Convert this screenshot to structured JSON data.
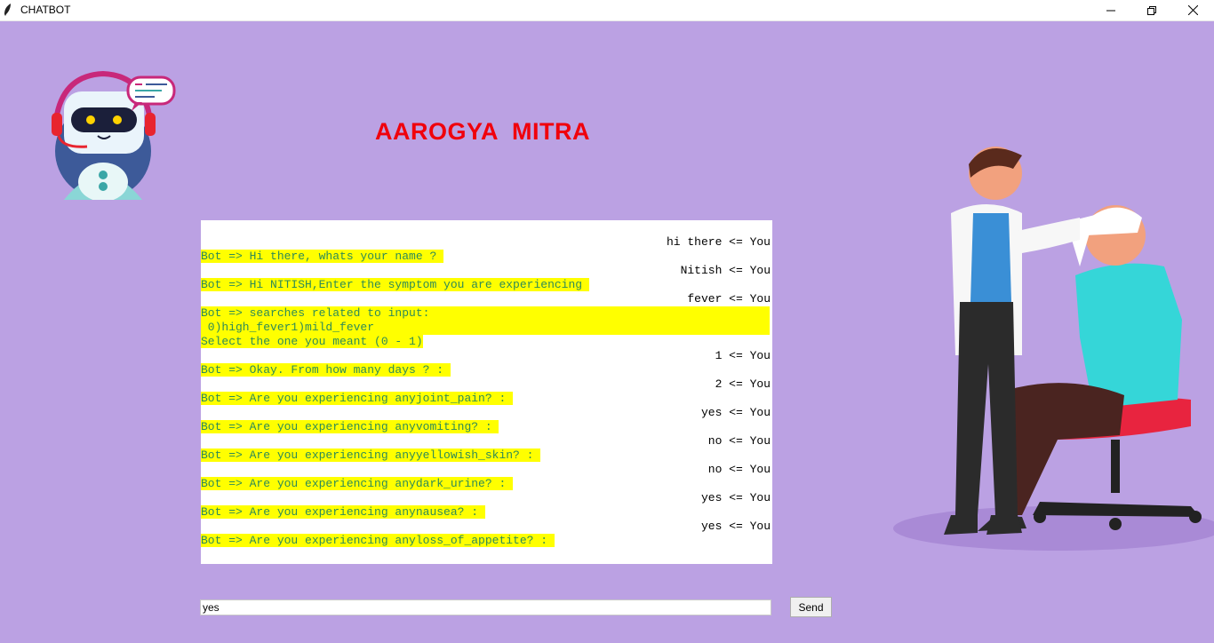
{
  "window": {
    "title": "CHATBOT"
  },
  "heading": "AAROGYA  MITRA",
  "chat": [
    {
      "role": "user",
      "text": "hi there <= You"
    },
    {
      "role": "bot",
      "text": "Bot => Hi there, whats your name ? "
    },
    {
      "role": "user",
      "text": "Nitish <= You"
    },
    {
      "role": "bot",
      "text": "Bot => Hi NITISH,Enter the symptom you are experiencing "
    },
    {
      "role": "user",
      "text": "fever <= You"
    },
    {
      "role": "bot-full",
      "text": "Bot => searches related to input: "
    },
    {
      "role": "bot-full",
      "text": " 0)high_fever1)mild_fever"
    },
    {
      "role": "bot",
      "text": "Select the one you meant (0 - 1)"
    },
    {
      "role": "user",
      "text": "1 <= You"
    },
    {
      "role": "bot",
      "text": "Bot => Okay. From how many days ? : "
    },
    {
      "role": "user",
      "text": "2 <= You"
    },
    {
      "role": "bot",
      "text": "Bot => Are you experiencing anyjoint_pain? : "
    },
    {
      "role": "user",
      "text": "yes <= You"
    },
    {
      "role": "bot",
      "text": "Bot => Are you experiencing anyvomiting? : "
    },
    {
      "role": "user",
      "text": "no <= You"
    },
    {
      "role": "bot",
      "text": "Bot => Are you experiencing anyyellowish_skin? : "
    },
    {
      "role": "user",
      "text": "no <= You"
    },
    {
      "role": "bot",
      "text": "Bot => Are you experiencing anydark_urine? : "
    },
    {
      "role": "user",
      "text": "yes <= You"
    },
    {
      "role": "bot",
      "text": "Bot => Are you experiencing anynausea? : "
    },
    {
      "role": "user",
      "text": "yes <= You"
    },
    {
      "role": "bot",
      "text": "Bot => Are you experiencing anyloss_of_appetite? : "
    }
  ],
  "input": {
    "value": "yes"
  },
  "send_label": "Send",
  "icons": {
    "app": "feather-icon",
    "minimize": "minimize-icon",
    "maximize": "restore-icon",
    "close": "close-icon",
    "logo": "robot-headset-icon",
    "illustration": "doctor-bandaging-patient"
  },
  "colors": {
    "background": "#bba1e3",
    "heading": "#f0000c",
    "bot_highlight": "#ffff00",
    "bot_text": "#2e8b57"
  }
}
